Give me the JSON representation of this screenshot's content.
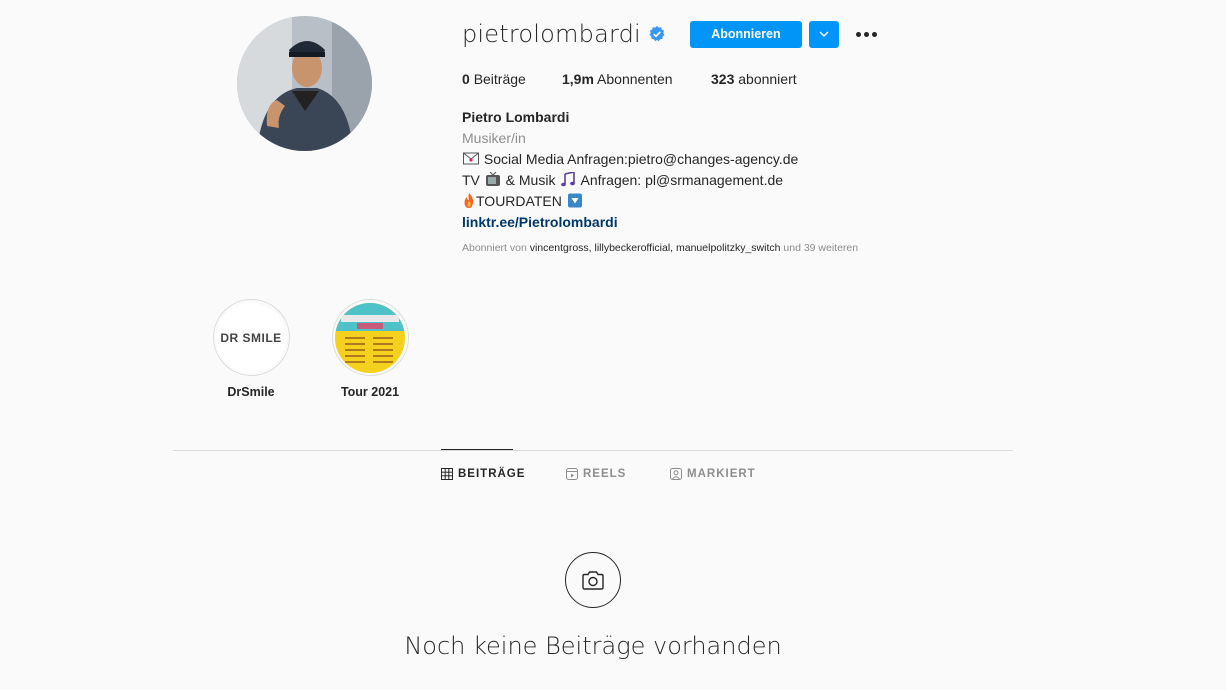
{
  "profile": {
    "username": "pietrolombardi",
    "follow_label": "Abonnieren",
    "stats": {
      "posts_count": "0",
      "posts_label": "Beiträge",
      "followers_count": "1,9m",
      "followers_label": "Abonnenten",
      "following_count": "323",
      "following_label": "abonniert"
    },
    "bio": {
      "name": "Pietro Lombardi",
      "category": "Musiker/in",
      "line1": "Social Media Anfragen:pietro@changes-agency.de",
      "line2_a": "TV",
      "line2_b": "& Musik",
      "line2_c": "Anfragen: pl@srmanagement.de",
      "line3": "TOURDATEN",
      "link": "linktr.ee/Pietrolombardi"
    },
    "followed_by": {
      "prefix": "Abonniert von",
      "users": "vincentgross, lillybeckerofficial, manuelpolitzky_switch",
      "suffix": "und 39 weiteren"
    }
  },
  "highlights": [
    {
      "label": "DrSmile",
      "logo_text": "DR SMILE"
    },
    {
      "label": "Tour 2021"
    }
  ],
  "tabs": [
    {
      "label": "BEITRÄGE",
      "active": true
    },
    {
      "label": "REELS",
      "active": false
    },
    {
      "label": "MARKIERT",
      "active": false
    }
  ],
  "empty_state": {
    "message": "Noch keine Beiträge vorhanden"
  },
  "colors": {
    "accent": "#0095f6",
    "link": "#00376b",
    "muted": "#8e8e8e",
    "verified": "#3897f0"
  }
}
